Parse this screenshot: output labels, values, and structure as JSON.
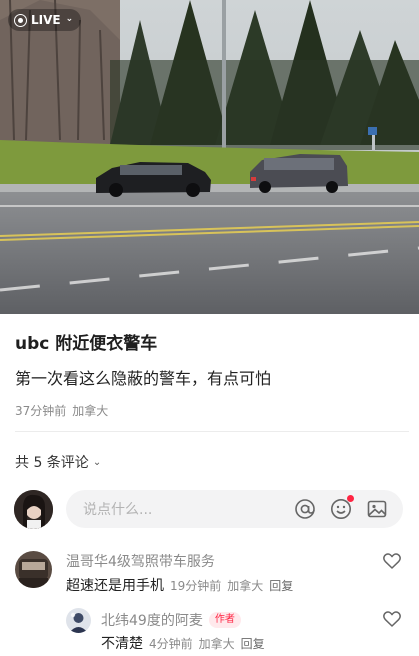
{
  "photo": {
    "live_label": "LIVE",
    "live_chevron": "⌄",
    "live_icon": "live-icon"
  },
  "post": {
    "title": "ubc 附近便衣警车",
    "body": "第一次看这么隐蔽的警车，有点可怕",
    "time": "37分钟前",
    "location": "加拿大"
  },
  "comments_header": {
    "label": "共 5 条评论",
    "chevron": "⌄"
  },
  "input": {
    "placeholder": "说点什么...",
    "icons": [
      "at-icon",
      "emoji-icon",
      "image-icon"
    ],
    "notification_dot_color": "#ff2442"
  },
  "comments": [
    {
      "username": "温哥华4级驾照带车服务",
      "text": "超速还是用手机",
      "time": "19分钟前",
      "location": "加拿大",
      "reply_label": "回复"
    },
    {
      "username": "北纬49度的阿麦",
      "badge": "作者",
      "text": "不清楚",
      "time": "4分钟前",
      "location": "加拿大",
      "reply_label": "回复"
    }
  ],
  "colors": {
    "accent_red": "#ff2442",
    "meta_gray": "#8a8a8a"
  }
}
